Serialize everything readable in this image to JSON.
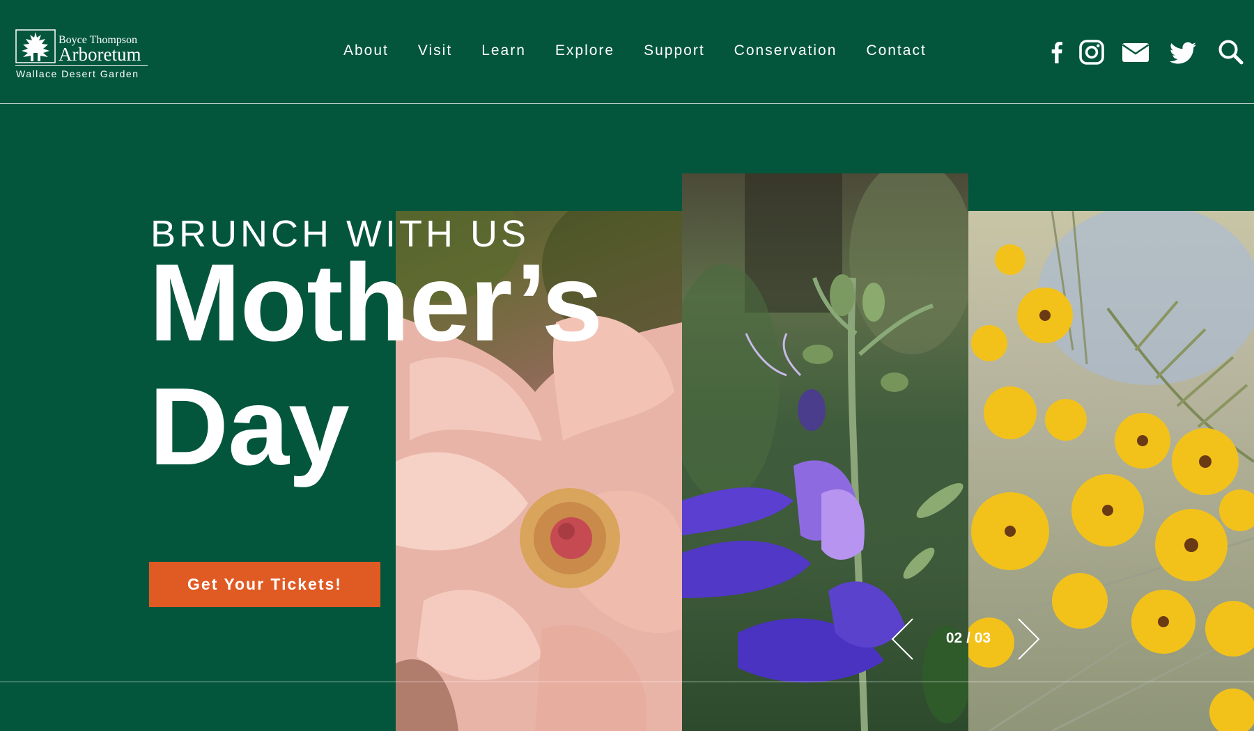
{
  "brand": {
    "line1": "Boyce Thompson",
    "line2": "Arboretum",
    "line3": "Wallace Desert Garden"
  },
  "nav": {
    "items": [
      "About",
      "Visit",
      "Learn",
      "Explore",
      "Support",
      "Conservation",
      "Contact"
    ]
  },
  "social": {
    "icons": [
      "facebook-icon",
      "instagram-icon",
      "mail-icon",
      "twitter-icon",
      "search-icon"
    ]
  },
  "hero": {
    "kicker": "BRUNCH WITH US",
    "title_line1": "Mother’s",
    "title_line2": "Day",
    "cta_label": "Get Your Tickets!",
    "slider_counter": "02 / 03"
  },
  "colors": {
    "background": "#03563c",
    "accent": "#e05a24",
    "text": "#ffffff"
  }
}
